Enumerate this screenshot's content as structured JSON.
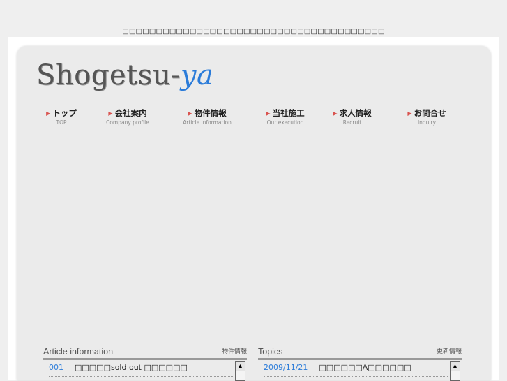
{
  "banner": "□□□□□□□□□□□□□□□□□□□□□□□□□□□□□□□□□□□□□□□",
  "logo": {
    "main": "Shogetsu-",
    "accent": "ya"
  },
  "nav": [
    {
      "jp": "トップ",
      "en": "TOP"
    },
    {
      "jp": "会社案内",
      "en": "Company profile"
    },
    {
      "jp": "物件情報",
      "en": "Article information"
    },
    {
      "jp": "当社施工",
      "en": "Our execution"
    },
    {
      "jp": "求人情報",
      "en": "Recruit"
    },
    {
      "jp": "お問合せ",
      "en": "Inquiry"
    }
  ],
  "articles": {
    "title": "Article information",
    "subtitle": "物件情報",
    "items": [
      {
        "num": "001",
        "text": "□□□□□sold out □□□□□□"
      }
    ]
  },
  "topics": {
    "title": "Topics",
    "subtitle": "更新情報",
    "items": [
      {
        "date": "2009/11/21",
        "text": "□□□□□□A□□□□□□"
      }
    ]
  },
  "icons": {
    "scroll_up": "▲",
    "nav_arrow": "▶"
  }
}
